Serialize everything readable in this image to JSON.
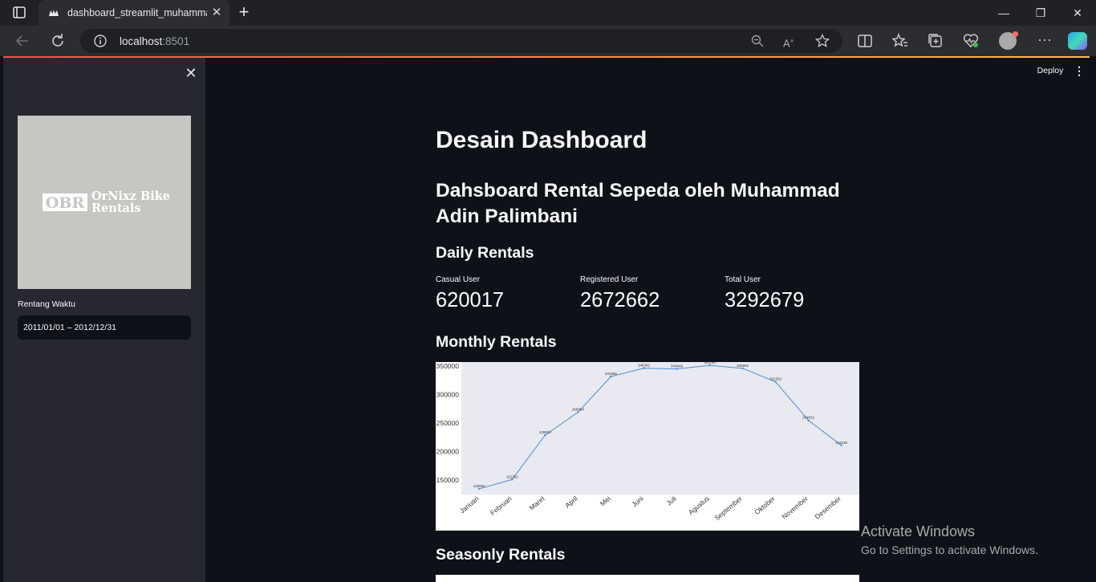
{
  "browser": {
    "tab_title": "dashboard_streamlit_muhammadadinpalimbani",
    "url_host": "localhost",
    "url_port": ":8501"
  },
  "sidebar": {
    "logo": {
      "mark": "OBR",
      "name": "OrNixz Bike Rentals"
    },
    "date_label": "Rentang Waktu",
    "date_value": "2011/01/01 – 2012/12/31"
  },
  "header": {
    "deploy_label": "Deploy"
  },
  "main": {
    "title": "Desain Dashboard",
    "subtitle": "Dahsboard Rental Sepeda oleh Muhammad Adin Palimbani",
    "daily_heading": "Daily Rentals",
    "monthly_heading": "Monthly Rentals",
    "seasonly_heading": "Seasonly Rentals",
    "metrics": [
      {
        "label": "Casual User",
        "value": "620017"
      },
      {
        "label": "Registered User",
        "value": "2672662"
      },
      {
        "label": "Total User",
        "value": "3292679"
      }
    ]
  },
  "chart_data": {
    "type": "line",
    "categories": [
      "Januari",
      "Februari",
      "Maret",
      "April",
      "Mei",
      "Juni",
      "Juli",
      "Agustus",
      "September",
      "Oktober",
      "November",
      "Desember"
    ],
    "values": [
      134933,
      151352,
      228920,
      269094,
      331686,
      346342,
      344948,
      351194,
      345991,
      322352,
      254831,
      211036
    ],
    "yticks": [
      150000,
      200000,
      250000,
      300000,
      350000
    ],
    "ylim": [
      125000,
      357000
    ],
    "colors": {
      "line": "#4c8fcf",
      "background": "#e8e9f1"
    }
  },
  "watermark": {
    "title": "Activate Windows",
    "subtitle": "Go to Settings to activate Windows."
  }
}
